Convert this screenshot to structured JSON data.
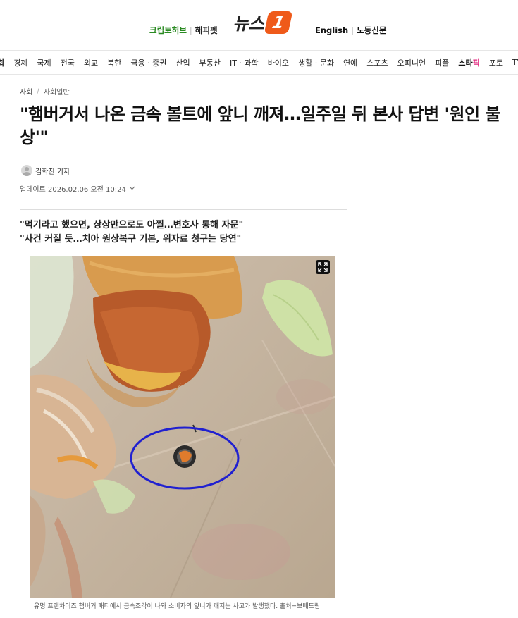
{
  "header": {
    "left_link_1": "크립토허브",
    "left_link_2": "해피펫",
    "logo_text": "뉴스",
    "logo_mark": "1",
    "right_link_1": "English",
    "right_link_2": "노동신문"
  },
  "nav": {
    "items": [
      "회",
      "경제",
      "국제",
      "전국",
      "외교",
      "북한",
      "금융 · 증권",
      "산업",
      "부동산",
      "IT · 과학",
      "바이오",
      "생활 · 문화",
      "연예",
      "스포츠",
      "오피니언",
      "피플"
    ],
    "star_a": "스타",
    "star_b": "픽",
    "tail": [
      "포토",
      "TV"
    ]
  },
  "breadcrumb": {
    "section": "사회",
    "subsection": "사회일반"
  },
  "article": {
    "headline": "\"햄버거서 나온 금속 볼트에 앞니 깨져…일주일 뒤 본사 답변 '원인 불상'\"",
    "reporter": "김학진 기자",
    "updated": "업데이트 2026.02.06 오전 10:24",
    "summary_1": "\"먹기라고 했으면, 상상만으로도 아찔…변호사 통해 자문\"",
    "summary_2": "\"사건 커질 듯…치아 원상복구 기본, 위자료 청구는 당연\"",
    "caption": "유명 프랜차이즈 햄버거 패티에서 금속조각이 나와 소비자의 앞니가 깨지는 사고가 발생했다. 출처=보배드림"
  },
  "icons": {
    "expand": "expand-icon",
    "chevron": "chevron-down-icon",
    "avatar": "user-avatar-icon"
  },
  "colors": {
    "brand_orange": "#ef5a1a",
    "green_link": "#2a8a22",
    "star_pink": "#e0267c",
    "highlight_circle": "#2020d0"
  }
}
